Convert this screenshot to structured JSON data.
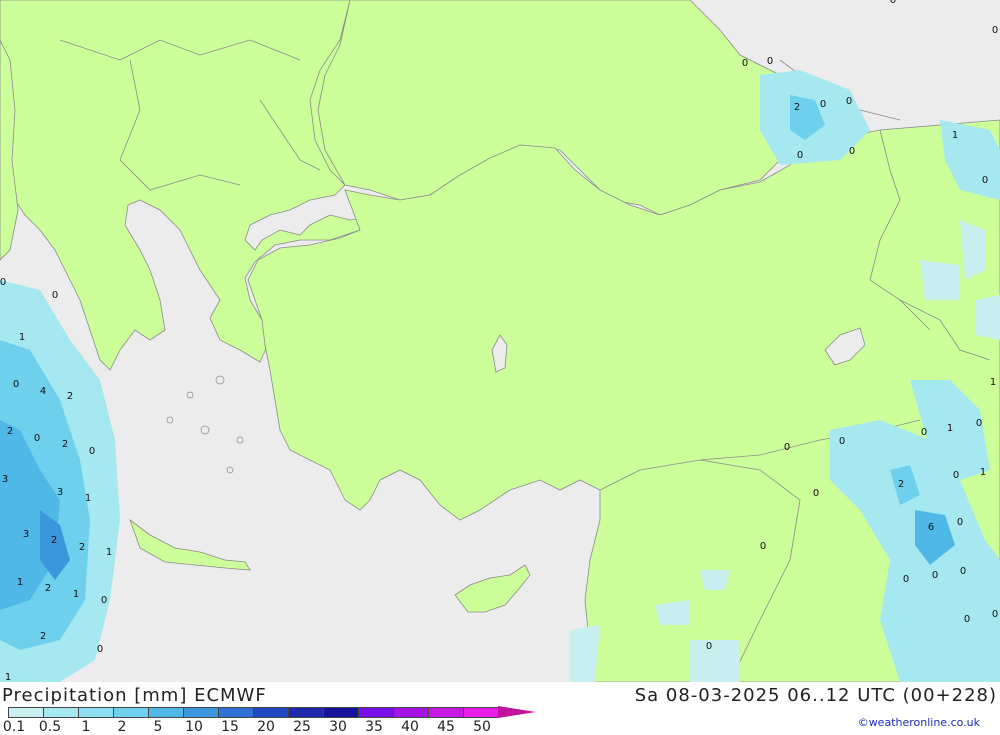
{
  "header": {
    "title": "Precipitation [mm] ECMWF",
    "datetime": "Sa 08-03-2025 06..12 UTC (00+228)",
    "credit": "©weatheronline.co.uk"
  },
  "colors": {
    "sea": "#ececec",
    "land": "#ccff99",
    "border": "#8a8a8a"
  },
  "legend": {
    "ticks": [
      "0.1",
      "0.5",
      "1",
      "2",
      "5",
      "10",
      "15",
      "20",
      "25",
      "30",
      "35",
      "40",
      "45",
      "50"
    ],
    "colors": [
      "#c8f0f0",
      "#a5e8f0",
      "#8ce0f0",
      "#6ed0ec",
      "#50b8e6",
      "#3c96dc",
      "#2f72d2",
      "#2346c3",
      "#1e28aa",
      "#14129a",
      "#7a10e8",
      "#a414e6",
      "#c818e4",
      "#e81ce8",
      "#c0149e"
    ]
  },
  "map_values": [
    {
      "v": "0"
    },
    {
      "v": "0"
    },
    {
      "v": "2"
    },
    {
      "v": "0"
    },
    {
      "v": "0"
    },
    {
      "v": "0"
    },
    {
      "v": "0"
    },
    {
      "v": "1"
    },
    {
      "v": "0"
    },
    {
      "v": "0"
    },
    {
      "v": "0"
    },
    {
      "v": "1"
    },
    {
      "v": "0"
    },
    {
      "v": "4"
    },
    {
      "v": "2"
    },
    {
      "v": "2"
    },
    {
      "v": "0"
    },
    {
      "v": "2"
    },
    {
      "v": "0"
    },
    {
      "v": "3"
    },
    {
      "v": "3"
    },
    {
      "v": "1"
    },
    {
      "v": "3"
    },
    {
      "v": "2"
    },
    {
      "v": "2"
    },
    {
      "v": "1"
    },
    {
      "v": "1"
    },
    {
      "v": "2"
    },
    {
      "v": "1"
    },
    {
      "v": "0"
    },
    {
      "v": "2"
    },
    {
      "v": "0"
    },
    {
      "v": "0"
    },
    {
      "v": "0"
    },
    {
      "v": "0"
    },
    {
      "v": "0"
    },
    {
      "v": "0"
    },
    {
      "v": "1"
    },
    {
      "v": "0"
    },
    {
      "v": "1"
    },
    {
      "v": "0"
    },
    {
      "v": "2"
    },
    {
      "v": "0"
    },
    {
      "v": "6"
    },
    {
      "v": "0"
    },
    {
      "v": "0"
    },
    {
      "v": "0"
    },
    {
      "v": "0"
    },
    {
      "v": "0"
    },
    {
      "v": "0"
    },
    {
      "v": "0"
    },
    {
      "v": "1"
    },
    {
      "v": "0"
    },
    {
      "v": "1"
    }
  ]
}
